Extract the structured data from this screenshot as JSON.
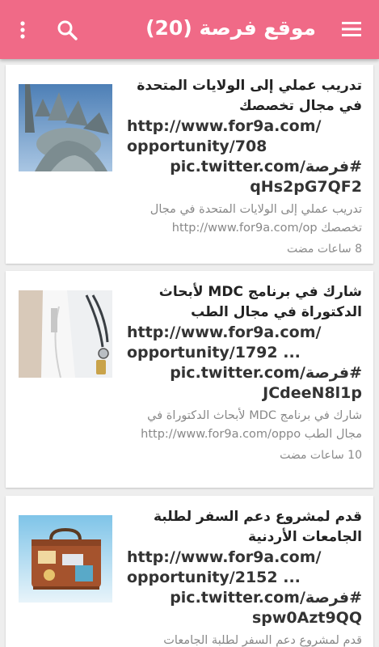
{
  "app": {
    "title": "موقع فرصة (20)",
    "accent_color": "#f06a87"
  },
  "icons": {
    "menu": "hamburger-menu-icon",
    "search": "search-icon",
    "more": "more-vertical-icon"
  },
  "posts": [
    {
      "headline": "تدريب عملي إلى الولايات المتحدة في مجال تخصصك",
      "link_line1": "http://www.for9a.com/",
      "link_line2": "opportunity/708",
      "tweet_tag": "#فرصة/pic.twitter.com",
      "tweet_code": "qHs2pG7QF2",
      "description": "تدريب عملي إلى الولايات المتحدة في مجال تخصصك http://www.for9a.com/op",
      "time": "8 ساعات مضت",
      "image": "statue-of-liberty"
    },
    {
      "headline": "شارك في برنامج MDC لأبحاث الدكتوراة في مجال الطب",
      "link_line1": "http://www.for9a.com/",
      "link_line2": "opportunity/1792 ...",
      "tweet_tag": "#فرصة/pic.twitter.com",
      "tweet_code": "JCdeeN8l1p",
      "description": "شارك في برنامج MDC لأبحاث الدكتوراة في مجال الطب http://www.for9a.com/oppo",
      "time": "10 ساعات مضت",
      "image": "doctor-stethoscope"
    },
    {
      "headline": "قدم لمشروع دعم السفر لطلبة الجامعات الأردنية",
      "link_line1": "http://www.for9a.com/",
      "link_line2": "opportunity/2152 ...",
      "tweet_tag": "#فرصة/pic.twitter.com",
      "tweet_code": "spw0Azt9QQ",
      "description": "قدم لمشروع دعم السفر لطلبة الجامعات",
      "time": "",
      "image": "vintage-suitcase"
    }
  ]
}
